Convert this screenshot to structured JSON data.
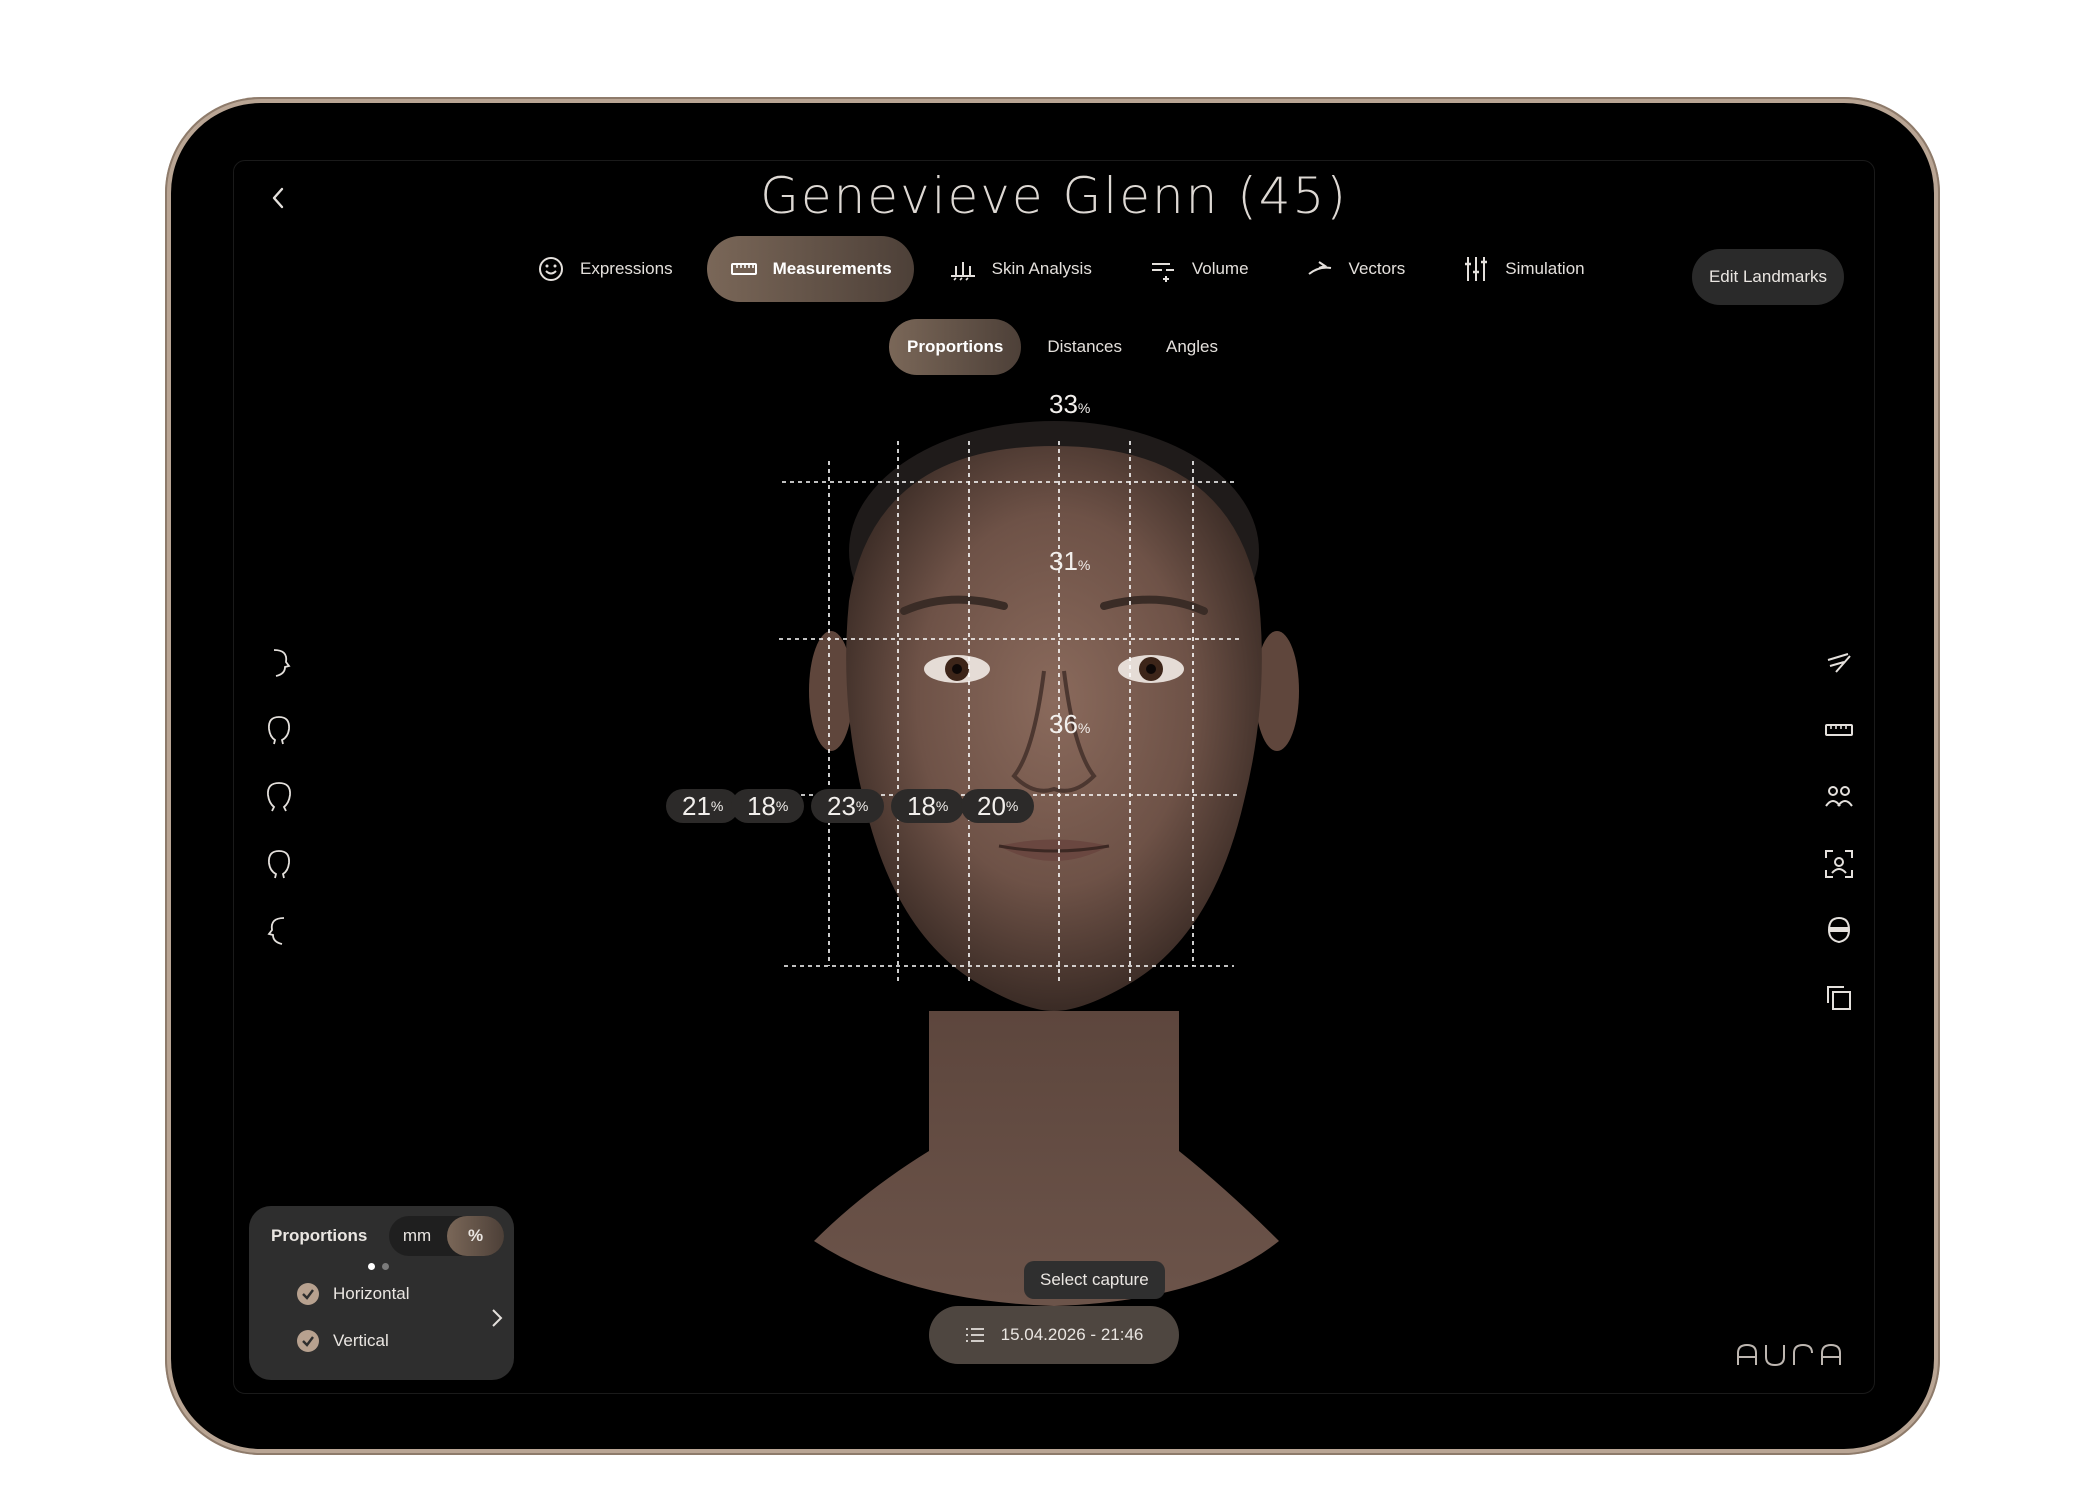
{
  "header": {
    "patient_title": "Genevieve Glenn (45)"
  },
  "nav": {
    "tabs": [
      {
        "label": "Expressions",
        "icon": "smile-icon"
      },
      {
        "label": "Measurements",
        "icon": "ruler-icon",
        "active": true
      },
      {
        "label": "Skin Analysis",
        "icon": "skin-icon"
      },
      {
        "label": "Volume",
        "icon": "volume-icon"
      },
      {
        "label": "Vectors",
        "icon": "vectors-icon"
      },
      {
        "label": "Simulation",
        "icon": "sliders-icon"
      }
    ],
    "edit_button": "Edit Landmarks"
  },
  "subtabs": [
    {
      "label": "Proportions",
      "active": true
    },
    {
      "label": "Distances"
    },
    {
      "label": "Angles"
    }
  ],
  "measurements": {
    "vertical": [
      {
        "value": "33",
        "unit": "%"
      },
      {
        "value": "31",
        "unit": "%"
      },
      {
        "value": "36",
        "unit": "%"
      }
    ],
    "horizontal": [
      {
        "value": "21",
        "unit": "%"
      },
      {
        "value": "18",
        "unit": "%"
      },
      {
        "value": "23",
        "unit": "%"
      },
      {
        "value": "18",
        "unit": "%"
      },
      {
        "value": "20",
        "unit": "%"
      }
    ]
  },
  "left_toolbar": [
    "profile-right-icon",
    "three-quarter-right-icon",
    "front-head-icon",
    "three-quarter-left-icon",
    "profile-left-icon"
  ],
  "right_toolbar": [
    "landmark-pen-icon",
    "ruler-icon",
    "compare-users-icon",
    "face-scan-icon",
    "head-mask-icon",
    "duplicate-icon"
  ],
  "panel": {
    "title": "Proportions",
    "unit_mm": "mm",
    "unit_pct": "%",
    "options": [
      {
        "label": "Horizontal",
        "checked": true
      },
      {
        "label": "Vertical",
        "checked": true
      }
    ]
  },
  "capture": {
    "tooltip": "Select capture",
    "date": "15.04.2026 - 21:46"
  },
  "brand": {
    "logo": "AURA",
    "accent": "#7a6758"
  }
}
